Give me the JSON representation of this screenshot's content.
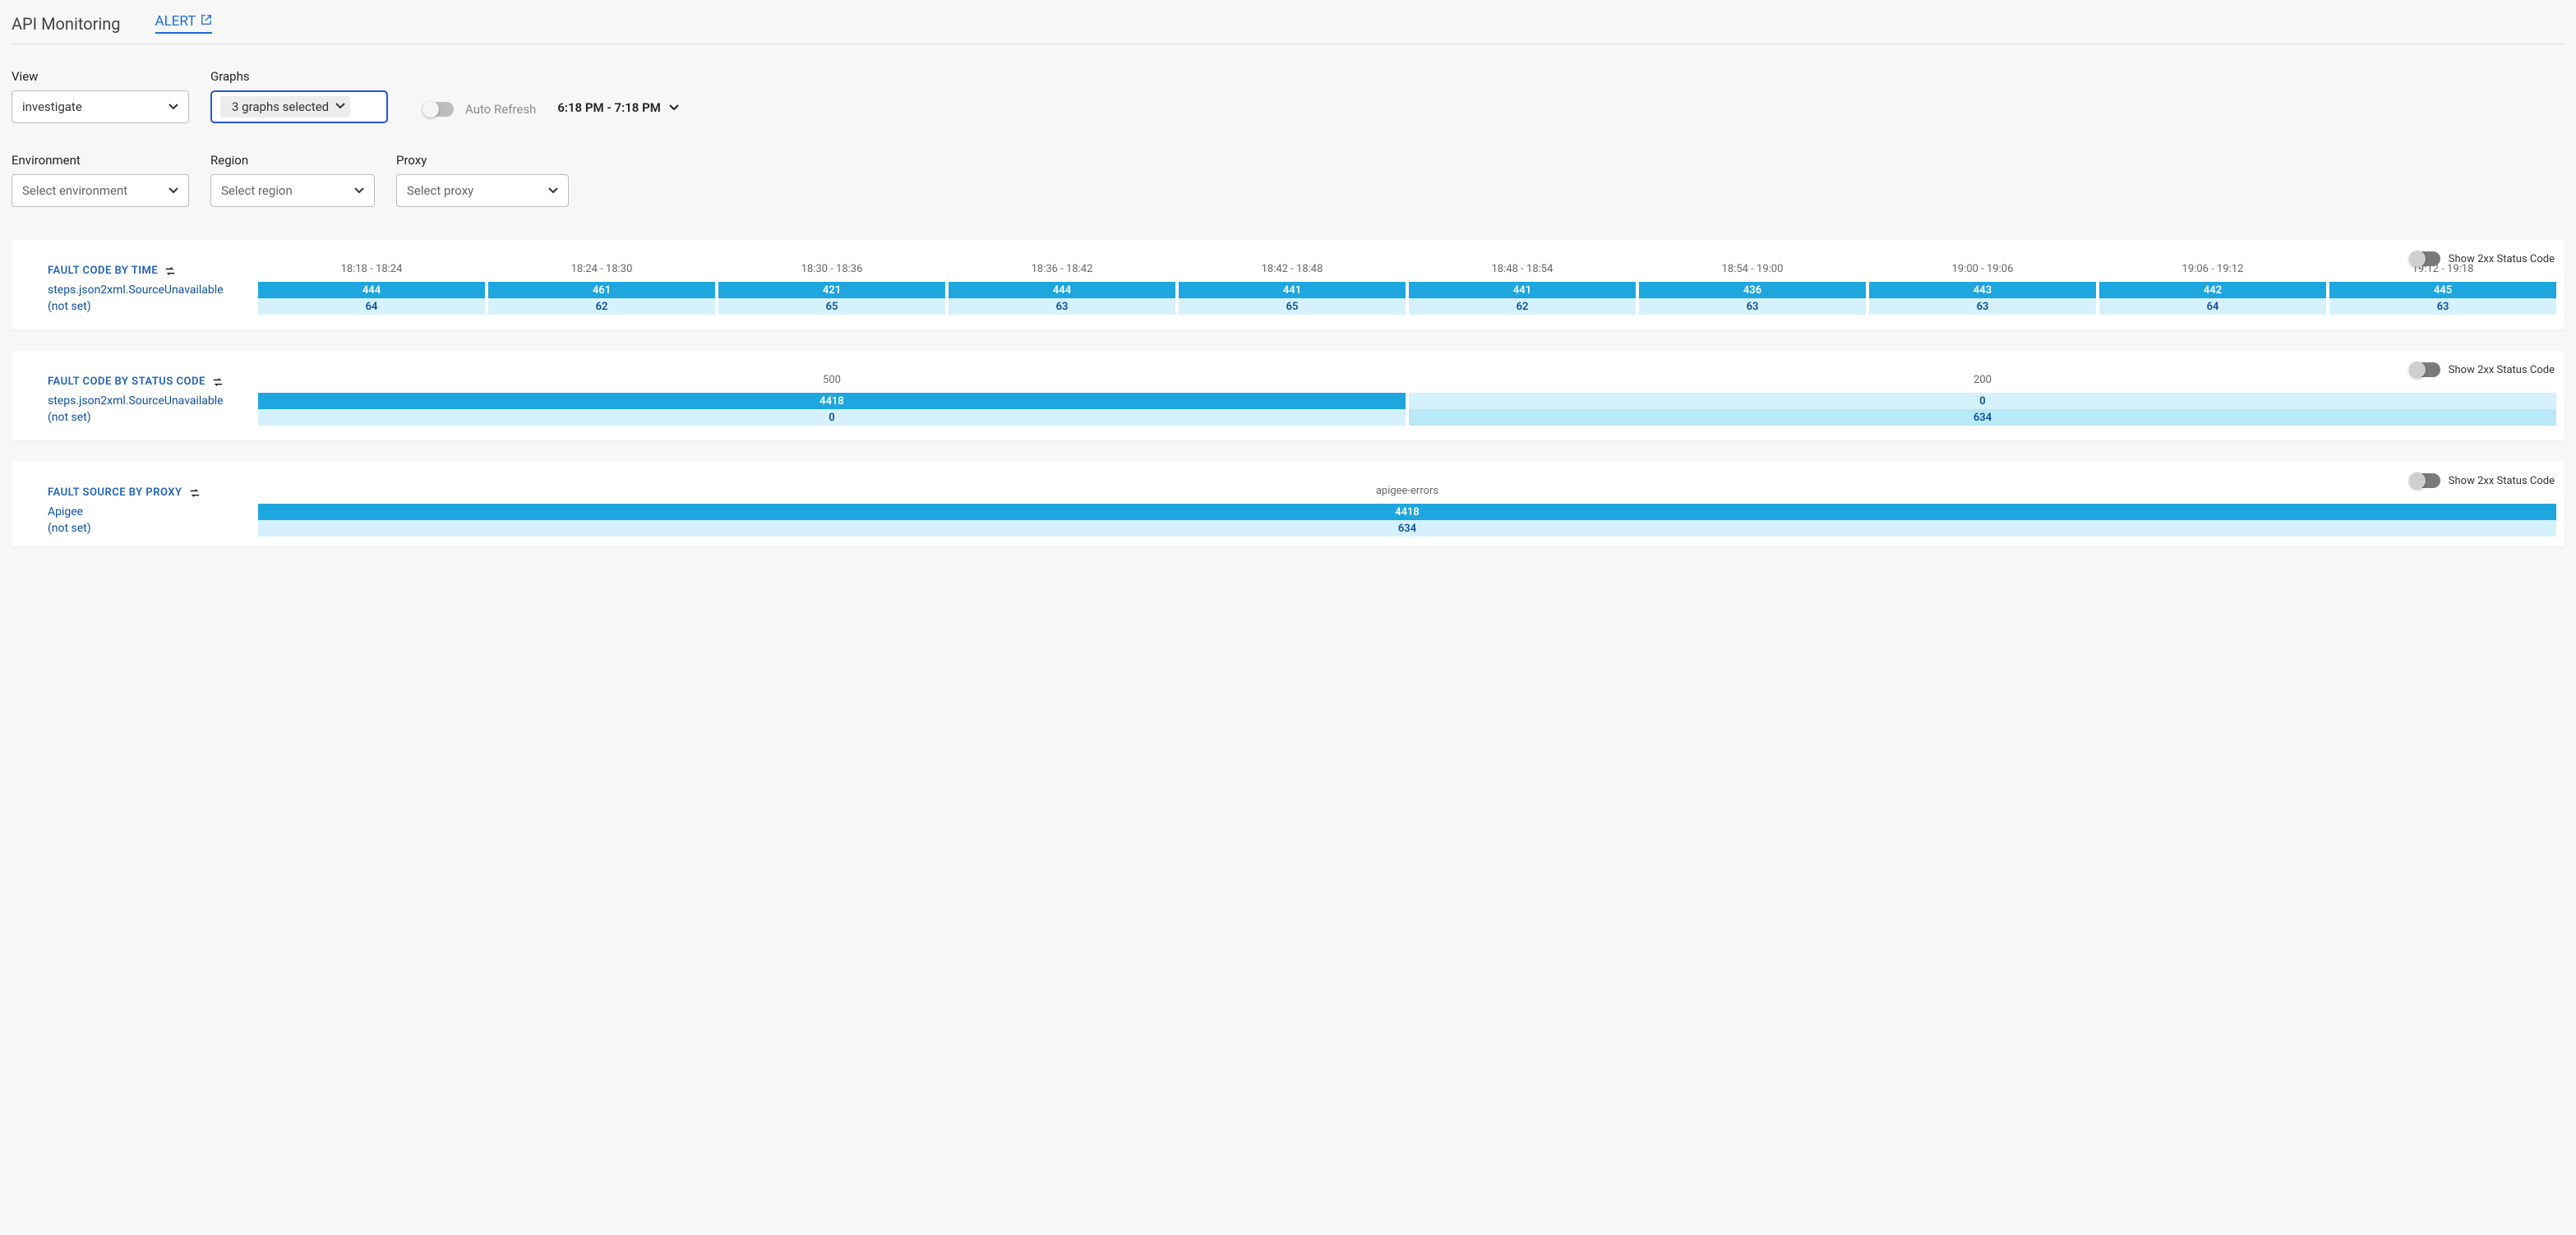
{
  "header": {
    "title": "API Monitoring",
    "alert_label": "ALERT"
  },
  "filters": {
    "view_label": "View",
    "view_value": "investigate",
    "graphs_label": "Graphs",
    "graphs_value": "3 graphs selected",
    "auto_refresh_label": "Auto Refresh",
    "timerange": "6:18 PM - 7:18 PM",
    "env_label": "Environment",
    "env_ph": "Select environment",
    "region_label": "Region",
    "region_ph": "Select region",
    "proxy_label": "Proxy",
    "proxy_ph": "Select proxy"
  },
  "toggle_label": "Show 2xx Status Code",
  "panel_time": {
    "title": "FAULT CODE BY TIME",
    "cols": [
      "18:18 - 18:24",
      "18:24 - 18:30",
      "18:30 - 18:36",
      "18:36 - 18:42",
      "18:42 - 18:48",
      "18:48 - 18:54",
      "18:54 - 19:00",
      "19:00 - 19:06",
      "19:06 - 19:12",
      "19:12 - 19:18"
    ],
    "row1_label": "steps.json2xml.SourceUnavailable",
    "row1": [
      "444",
      "461",
      "421",
      "444",
      "441",
      "441",
      "436",
      "443",
      "442",
      "445"
    ],
    "row2_label": "(not set)",
    "row2": [
      "64",
      "62",
      "65",
      "63",
      "65",
      "62",
      "63",
      "63",
      "64",
      "63"
    ]
  },
  "panel_status": {
    "title": "FAULT CODE BY STATUS CODE",
    "cols": [
      "500",
      "200"
    ],
    "row1_label": "steps.json2xml.SourceUnavailable",
    "row1_a": "4418",
    "row1_b": "0",
    "row2_label": "(not set)",
    "row2_a": "0",
    "row2_b": "634"
  },
  "panel_proxy": {
    "title": "FAULT SOURCE BY PROXY",
    "col": "apigee-errors",
    "row1_label": "Apigee",
    "row1": "4418",
    "row2_label": "(not set)",
    "row2": "634"
  },
  "chart_data": [
    {
      "type": "heatmap",
      "title": "Fault Code by Time",
      "x": [
        "18:18 - 18:24",
        "18:24 - 18:30",
        "18:30 - 18:36",
        "18:36 - 18:42",
        "18:42 - 18:48",
        "18:48 - 18:54",
        "18:54 - 19:00",
        "19:00 - 19:06",
        "19:06 - 19:12",
        "19:12 - 19:18"
      ],
      "series": [
        {
          "name": "steps.json2xml.SourceUnavailable",
          "values": [
            444,
            461,
            421,
            444,
            441,
            441,
            436,
            443,
            442,
            445
          ]
        },
        {
          "name": "(not set)",
          "values": [
            64,
            62,
            65,
            63,
            65,
            62,
            63,
            63,
            64,
            63
          ]
        }
      ]
    },
    {
      "type": "table",
      "title": "Fault Code by Status Code",
      "columns": [
        "500",
        "200"
      ],
      "rows": [
        {
          "name": "steps.json2xml.SourceUnavailable",
          "values": [
            4418,
            0
          ]
        },
        {
          "name": "(not set)",
          "values": [
            0,
            634
          ]
        }
      ]
    },
    {
      "type": "table",
      "title": "Fault Source by Proxy",
      "columns": [
        "apigee-errors"
      ],
      "rows": [
        {
          "name": "Apigee",
          "values": [
            4418
          ]
        },
        {
          "name": "(not set)",
          "values": [
            634
          ]
        }
      ]
    }
  ]
}
